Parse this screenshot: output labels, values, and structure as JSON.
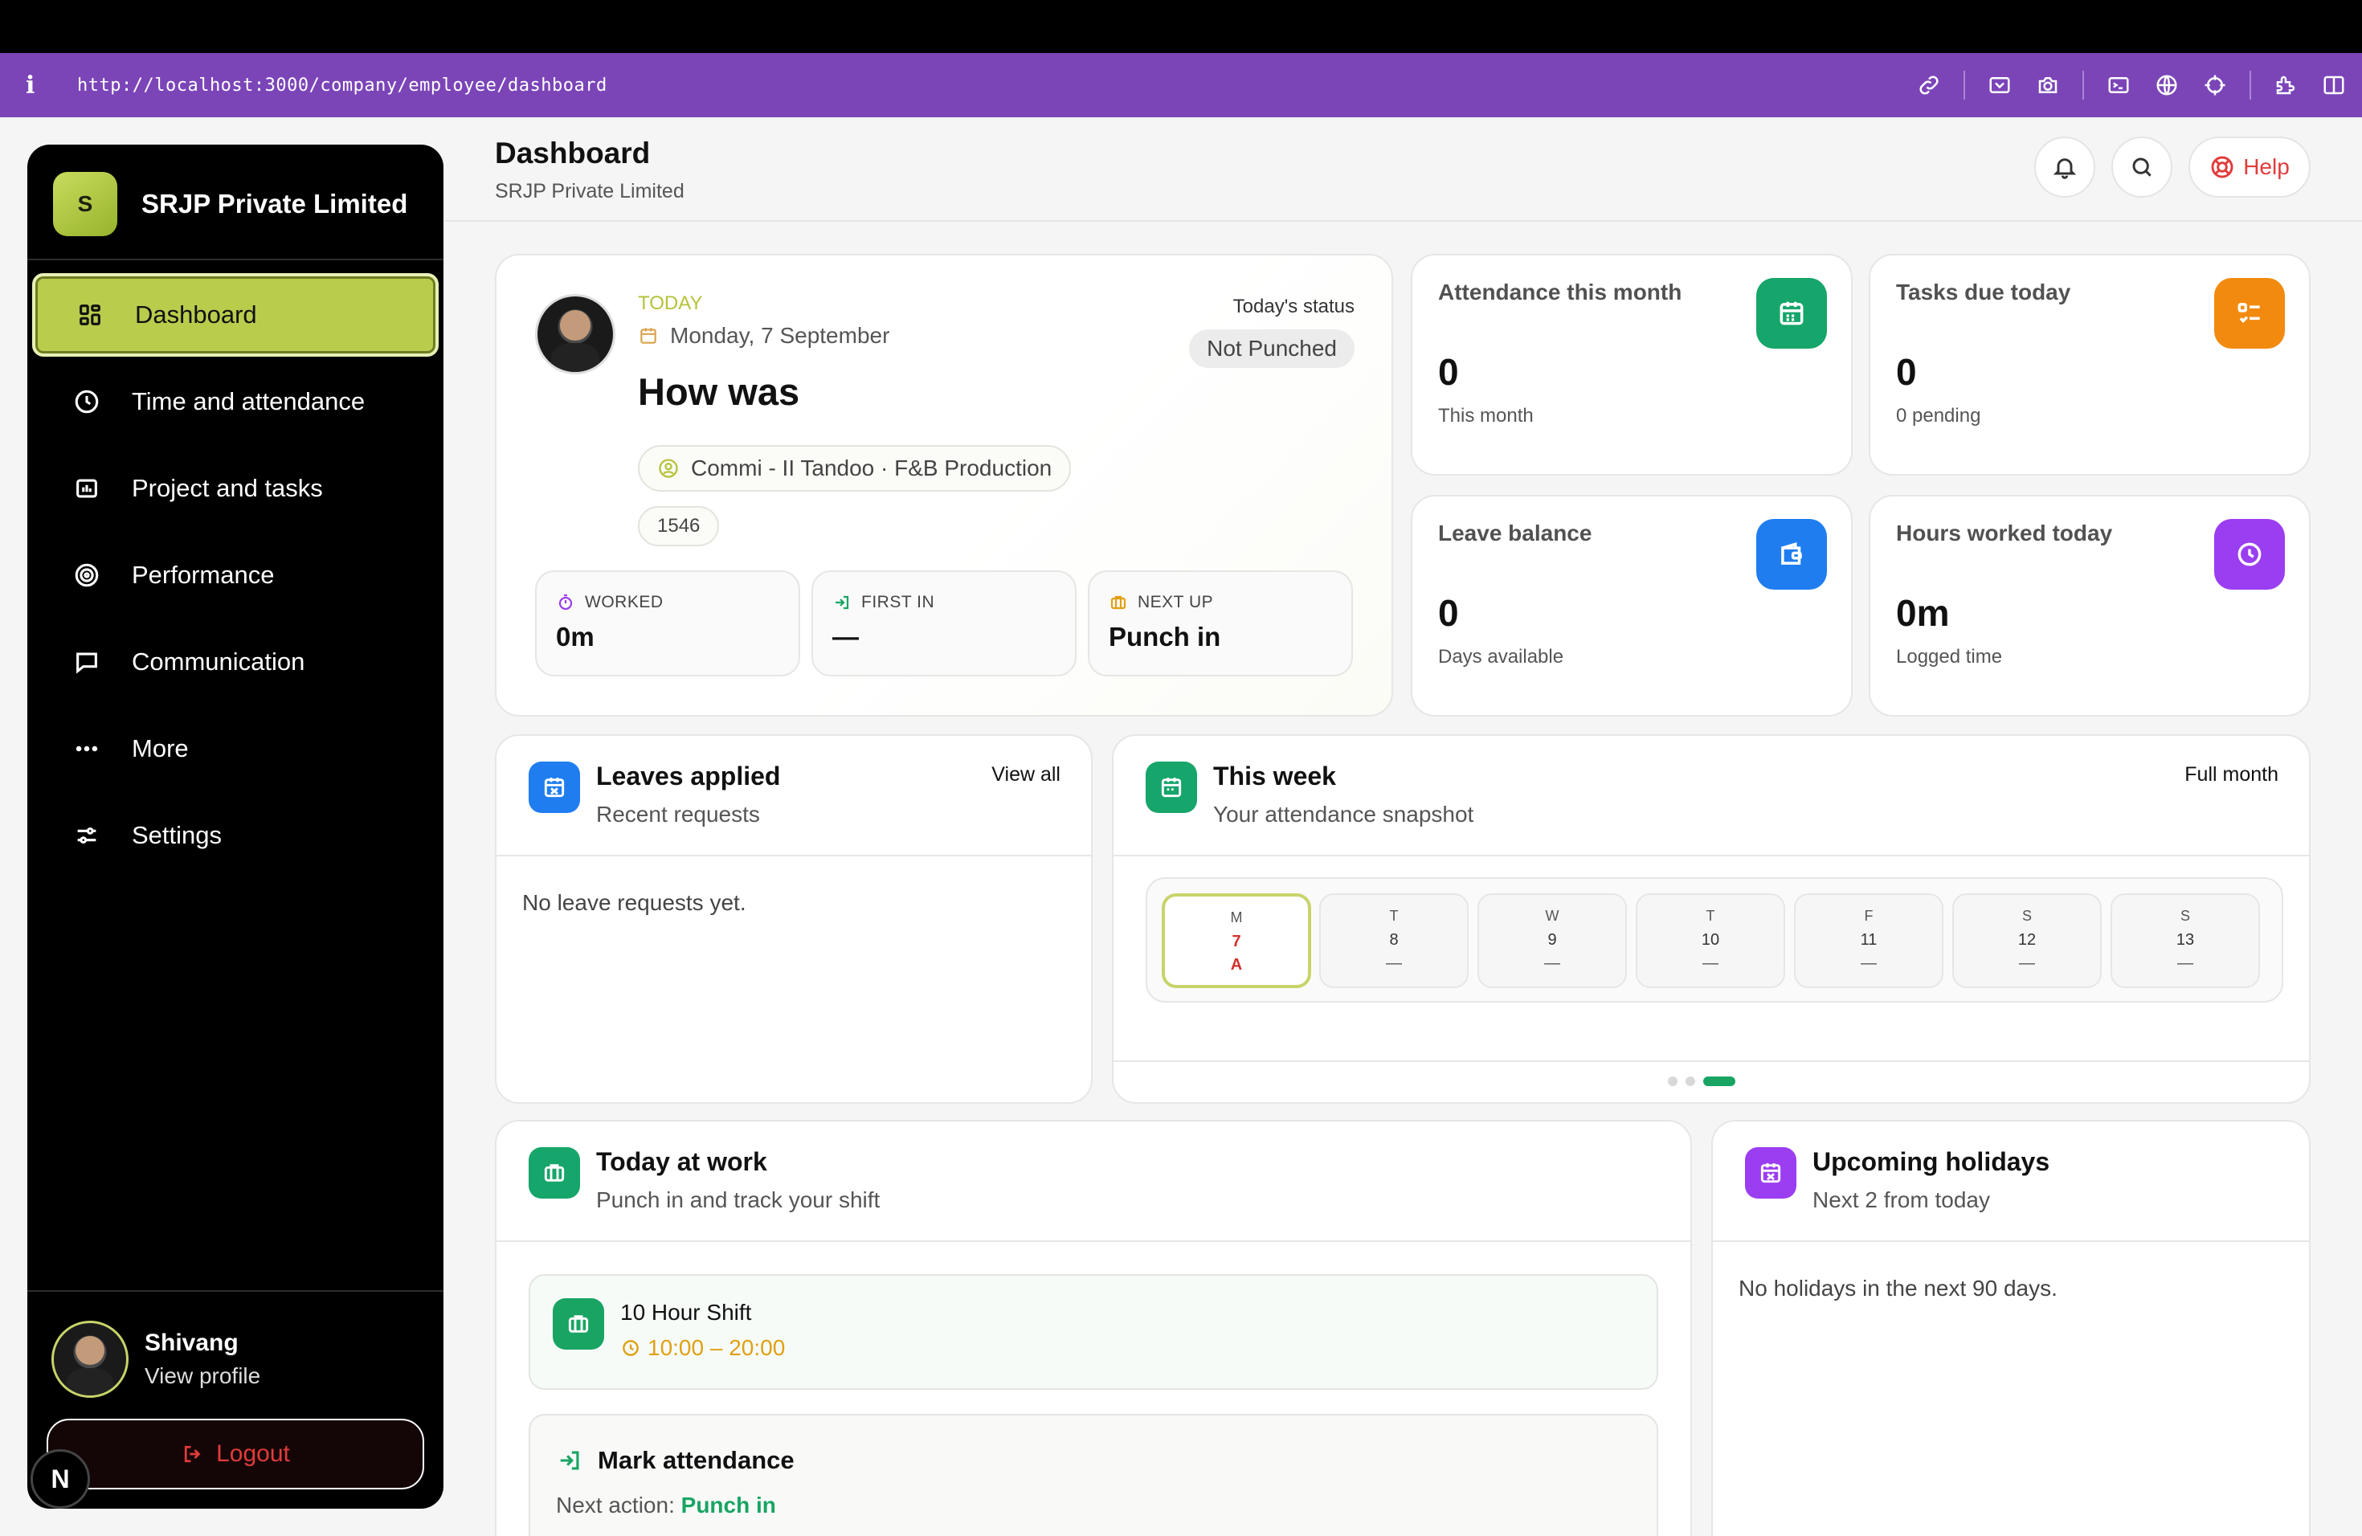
{
  "browser": {
    "url": "http://localhost:3000/company/employee/dashboard",
    "info_glyph": "i",
    "accent": "#7b45b8"
  },
  "sidebar": {
    "company_initial": "S",
    "company_name": "SRJP Private Limited",
    "items": [
      {
        "label": "Dashboard",
        "icon": "grid-icon",
        "active": true
      },
      {
        "label": "Time and attendance",
        "icon": "clock-icon"
      },
      {
        "label": "Project and tasks",
        "icon": "chart-icon"
      },
      {
        "label": "Performance",
        "icon": "target-icon"
      },
      {
        "label": "Communication",
        "icon": "message-icon"
      },
      {
        "label": "More",
        "icon": "more-icon"
      },
      {
        "label": "Settings",
        "icon": "sliders-icon"
      }
    ],
    "user": {
      "name": "Shivang",
      "link": "View profile"
    },
    "logout_label": "Logout",
    "dev_badge": "N"
  },
  "header": {
    "title": "Dashboard",
    "subtitle": "SRJP Private Limited",
    "help_label": "Help"
  },
  "today": {
    "label": "TODAY",
    "date": "Monday, 7 September",
    "greeting": "How was",
    "status_label": "Today's status",
    "status": "Not Punched",
    "position": "Commi - II Tandoo · F&B Production",
    "employee_id": "1546",
    "metrics": [
      {
        "label": "WORKED",
        "value": "0m"
      },
      {
        "label": "FIRST IN",
        "value": "—"
      },
      {
        "label": "NEXT UP",
        "value": "Punch in"
      }
    ]
  },
  "stats": [
    {
      "label": "Attendance this month",
      "value": "0",
      "sub": "This month",
      "color": "#16a56a",
      "icon": "calendar-icon"
    },
    {
      "label": "Tasks due today",
      "value": "0",
      "sub": "0 pending",
      "color": "#f28a0f",
      "icon": "checklist-icon"
    },
    {
      "label": "Leave balance",
      "value": "0",
      "sub": "Days available",
      "color": "#1f7df0",
      "icon": "wallet-icon"
    },
    {
      "label": "Hours worked today",
      "value": "0m",
      "sub": "Logged time",
      "color": "#9b3df0",
      "icon": "clock-icon"
    }
  ],
  "leaves": {
    "title": "Leaves applied",
    "subtitle": "Recent requests",
    "link": "View all",
    "empty": "No leave requests yet."
  },
  "week": {
    "title": "This week",
    "subtitle": "Your attendance snapshot",
    "link": "Full month",
    "days": [
      {
        "letter": "M",
        "num": "7",
        "status": "A",
        "today": true
      },
      {
        "letter": "T",
        "num": "8",
        "status": "—"
      },
      {
        "letter": "W",
        "num": "9",
        "status": "—"
      },
      {
        "letter": "T",
        "num": "10",
        "status": "—"
      },
      {
        "letter": "F",
        "num": "11",
        "status": "—"
      },
      {
        "letter": "S",
        "num": "12",
        "status": "—"
      },
      {
        "letter": "S",
        "num": "13",
        "status": "—"
      }
    ]
  },
  "work": {
    "title": "Today at work",
    "subtitle": "Punch in and track your shift",
    "shift_name": "10 Hour Shift",
    "shift_time": "10:00 – 20:00",
    "mark_title": "Mark attendance",
    "next_prefix": "Next action: ",
    "next_action": "Punch in"
  },
  "holidays": {
    "title": "Upcoming holidays",
    "subtitle": "Next 2 from today",
    "empty": "No holidays in the next 90 days."
  }
}
